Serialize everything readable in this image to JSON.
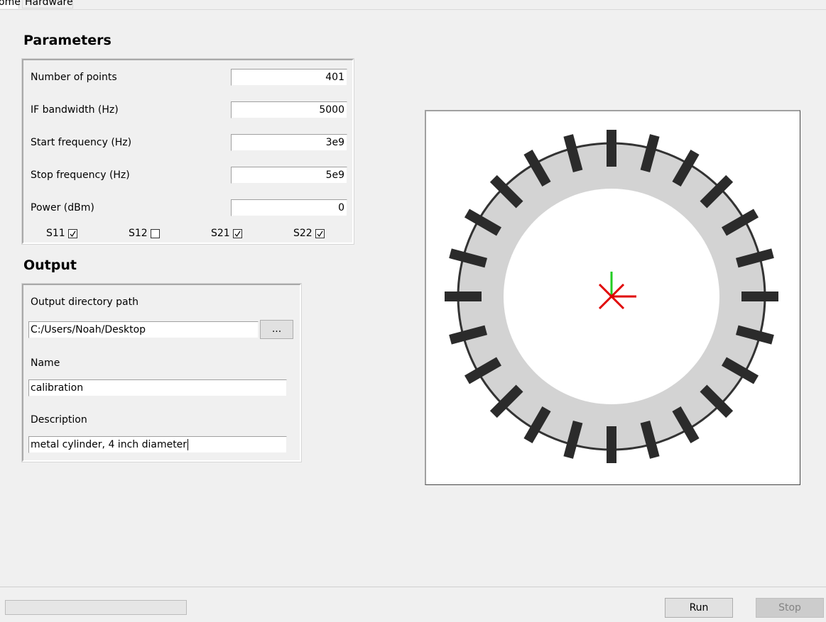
{
  "tabs": [
    {
      "label": "ome",
      "active": true
    },
    {
      "label": "Hardware",
      "active": false
    }
  ],
  "parameters": {
    "title": "Parameters",
    "fields": [
      {
        "label": "Number of points",
        "value": "401"
      },
      {
        "label": "IF bandwidth (Hz)",
        "value": "5000"
      },
      {
        "label": "Start frequency (Hz)",
        "value": "3e9"
      },
      {
        "label": "Stop frequency (Hz)",
        "value": "5e9"
      },
      {
        "label": "Power (dBm)",
        "value": "0"
      }
    ],
    "sparams": [
      {
        "label": "S11",
        "checked": true
      },
      {
        "label": "S12",
        "checked": false
      },
      {
        "label": "S21",
        "checked": true
      },
      {
        "label": "S22",
        "checked": true
      }
    ]
  },
  "output": {
    "title": "Output",
    "dir_label": "Output directory path",
    "dir_value": "C:/Users/Noah/Desktop",
    "browse_label": "...",
    "name_label": "Name",
    "name_value": "calibration",
    "desc_label": "Description",
    "desc_value": "metal cylinder, 4 inch diameter"
  },
  "viewer": {
    "antenna_count": 24,
    "ring_color": "#d3d3d3",
    "antenna_color": "#2b2b2b",
    "axis_x_color": "#e00000",
    "axis_y_color": "#22cc22"
  },
  "controls": {
    "run_label": "Run",
    "stop_label": "Stop",
    "progress": 0
  }
}
